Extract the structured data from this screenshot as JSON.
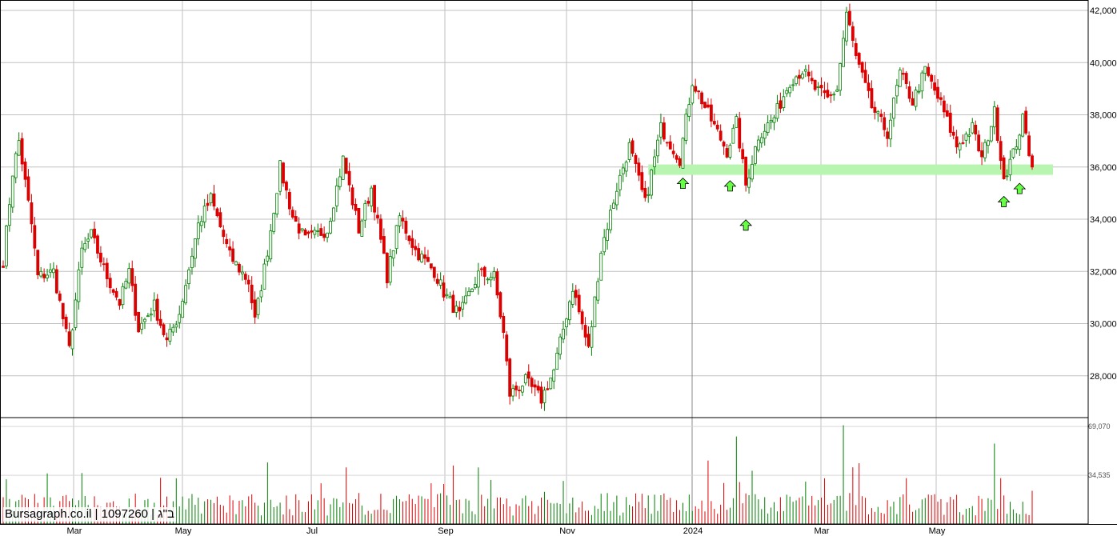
{
  "watermark": "Bursagraph.co.il | 1097260 | ב\"ג",
  "colors": {
    "up": "#008000",
    "down": "#dd0000",
    "grid": "#c0c0c0",
    "zone": "#b8f5b0",
    "arrow": "#66ff44"
  },
  "chart_data": {
    "type": "candlestick",
    "title": "",
    "price_axis": {
      "ylim": [
        26400,
        42400
      ],
      "ticks": [
        28000,
        30000,
        32000,
        34000,
        36000,
        38000,
        40000,
        42000
      ],
      "tick_labels": [
        "28,000",
        "30,000",
        "32,000",
        "34,000",
        "36,000",
        "38,000",
        "40,000",
        "42,000"
      ]
    },
    "volume_axis": {
      "ylim": [
        0,
        72000
      ],
      "ticks": [
        34535,
        69070
      ],
      "tick_labels": [
        "34,535",
        "69,070"
      ]
    },
    "x_labels": [
      "Mar",
      "May",
      "Jul",
      "Sep",
      "Nov",
      "2024",
      "Mar",
      "May"
    ],
    "support_zone": {
      "low": 35700,
      "high": 36100,
      "from_bar": 205,
      "to_bar": 330
    },
    "support_arrows": [
      {
        "bar": 216,
        "price": 35700
      },
      {
        "bar": 231,
        "price": 35600
      },
      {
        "bar": 236,
        "price": 34100
      },
      {
        "bar": 318,
        "price": 35000
      },
      {
        "bar": 323,
        "price": 35500
      }
    ],
    "anchors": [
      [
        0,
        32400
      ],
      [
        3,
        35800
      ],
      [
        5,
        37000
      ],
      [
        9,
        33800
      ],
      [
        11,
        31800
      ],
      [
        16,
        32000
      ],
      [
        19,
        30200
      ],
      [
        21,
        29000
      ],
      [
        25,
        32800
      ],
      [
        28,
        33400
      ],
      [
        33,
        31800
      ],
      [
        37,
        30800
      ],
      [
        40,
        32000
      ],
      [
        43,
        29800
      ],
      [
        48,
        30700
      ],
      [
        52,
        29300
      ],
      [
        56,
        30400
      ],
      [
        62,
        33800
      ],
      [
        66,
        34800
      ],
      [
        72,
        32600
      ],
      [
        78,
        31600
      ],
      [
        80,
        30100
      ],
      [
        84,
        32800
      ],
      [
        88,
        36000
      ],
      [
        92,
        34100
      ],
      [
        96,
        33200
      ],
      [
        103,
        33600
      ],
      [
        108,
        36300
      ],
      [
        113,
        33600
      ],
      [
        117,
        35200
      ],
      [
        122,
        31800
      ],
      [
        126,
        34100
      ],
      [
        131,
        32800
      ],
      [
        137,
        32000
      ],
      [
        140,
        31200
      ],
      [
        145,
        30300
      ],
      [
        151,
        31900
      ],
      [
        156,
        31800
      ],
      [
        159,
        29600
      ],
      [
        161,
        27300
      ],
      [
        166,
        27800
      ],
      [
        171,
        27100
      ],
      [
        175,
        28200
      ],
      [
        181,
        31400
      ],
      [
        186,
        29000
      ],
      [
        190,
        32800
      ],
      [
        195,
        35200
      ],
      [
        199,
        36800
      ],
      [
        204,
        34600
      ],
      [
        209,
        37500
      ],
      [
        215,
        36300
      ],
      [
        219,
        39300
      ],
      [
        225,
        37800
      ],
      [
        230,
        36600
      ],
      [
        233,
        37700
      ],
      [
        236,
        35300
      ],
      [
        240,
        37200
      ],
      [
        245,
        37900
      ],
      [
        250,
        39300
      ],
      [
        254,
        39700
      ],
      [
        258,
        39000
      ],
      [
        262,
        38600
      ],
      [
        265,
        39000
      ],
      [
        268,
        41900
      ],
      [
        271,
        40200
      ],
      [
        276,
        38300
      ],
      [
        281,
        37300
      ],
      [
        285,
        39600
      ],
      [
        289,
        38500
      ],
      [
        293,
        39700
      ],
      [
        298,
        38400
      ],
      [
        303,
        36800
      ],
      [
        308,
        37500
      ],
      [
        311,
        36300
      ],
      [
        315,
        38100
      ],
      [
        318,
        35600
      ],
      [
        321,
        36500
      ],
      [
        324,
        37800
      ],
      [
        327,
        36000
      ]
    ],
    "bars_total": 328,
    "note": ""
  }
}
